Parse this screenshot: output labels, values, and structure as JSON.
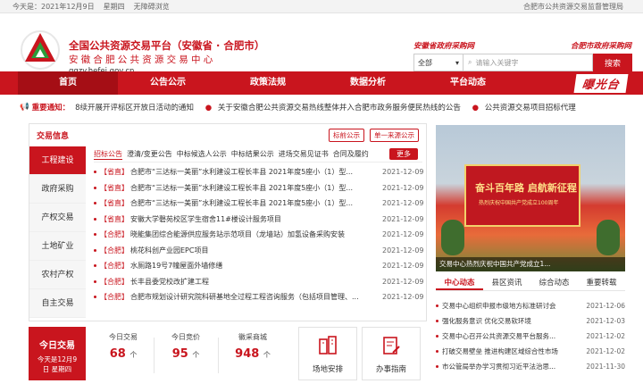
{
  "topbar": {
    "today_label": "今天是：",
    "date": "2021年12月9日",
    "weekday": "星期四",
    "accessibility": "无障碍浏览",
    "right": "合肥市公共资源交易监督管理局"
  },
  "header": {
    "title": "全国公共资源交易平台（安徽省 · 合肥市）",
    "subtitle": "安徽合肥公共资源交易中心",
    "url": "ggzy.hefei.gov.cn",
    "link1": "安徽省政府采购网",
    "link2": "合肥市政府采购网"
  },
  "search": {
    "select": "全部",
    "placeholder": "请输入关键字",
    "button": "搜索"
  },
  "nav": {
    "items": [
      "首页",
      "公告公示",
      "政策法规",
      "数据分析",
      "平台动态"
    ],
    "special": "曝光台"
  },
  "notice": {
    "label": "重要通知：",
    "items": [
      "8续开展开评标区开放日活动的通知",
      "关于安徽合肥公共资源交易热线整体并入合肥市政务服务便民热线的公告",
      "公共资源交易项目招标代理"
    ]
  },
  "transaction": {
    "title": "交易信息",
    "top_tabs": [
      "标前公示",
      "单一来源公示"
    ],
    "categories": [
      "工程建设",
      "政府采购",
      "产权交易",
      "土地矿业",
      "农村产权",
      "自主交易"
    ],
    "subtabs": [
      "招标公告",
      "澄清/变更公告",
      "中标候选人公示",
      "中标结果公示",
      "进场交易见证书",
      "合同及履约"
    ],
    "more": "更多",
    "rows": [
      {
        "tag": "【省直】",
        "text": "合肥市“三达标一美丽”水利建设工程长丰县 2021年度5座小（1）型...",
        "date": "2021-12-09"
      },
      {
        "tag": "【省直】",
        "text": "合肥市“三达标一美丽”水利建设工程长丰县 2021年度5座小（1）型...",
        "date": "2021-12-09"
      },
      {
        "tag": "【省直】",
        "text": "合肥市“三达标一美丽”水利建设工程长丰县 2021年度5座小（1）型...",
        "date": "2021-12-09"
      },
      {
        "tag": "【省直】",
        "text": "安徽大学磬苑校区学生宿舍11#楼设计服务项目",
        "date": "2021-12-09"
      },
      {
        "tag": "【合肥】",
        "text": "晓能集团综合能源供应服务站示范项目（龙墙站）加氢设备采购安装",
        "date": "2021-12-09"
      },
      {
        "tag": "【合肥】",
        "text": "桃花科创产业园EPC项目",
        "date": "2021-12-09"
      },
      {
        "tag": "【合肥】",
        "text": "水厕路19号7幢屋面外墙修缮",
        "date": "2021-12-09"
      },
      {
        "tag": "【合肥】",
        "text": "长丰县委党校改扩建工程",
        "date": "2021-12-09"
      },
      {
        "tag": "【合肥】",
        "text": "合肥市规划设计研究院科研基地全过程工程咨询服务（包括项目管理、...",
        "date": "2021-12-09"
      }
    ]
  },
  "photo": {
    "caption": "交易中心热烈庆祝中国共产党成立1...",
    "banner": "奋斗百年路 启航新征程",
    "banner_sub": "热烈庆祝中国共产党成立100周年"
  },
  "news": {
    "tabs": [
      "中心动态",
      "县区资讯",
      "综合动态",
      "重要转载"
    ],
    "rows": [
      {
        "text": "交易中心组织申报市级地方标准研讨会",
        "date": "2021-12-06"
      },
      {
        "text": "强化服务意识 优化交易软环境",
        "date": "2021-12-03"
      },
      {
        "text": "交易中心召开公共资源交易平台服务...",
        "date": "2021-12-02"
      },
      {
        "text": "打破交易壁垒 推进构建区域综合性市场",
        "date": "2021-12-02"
      },
      {
        "text": "市公管局举办学习贯彻习近平法治思...",
        "date": "2021-11-30"
      }
    ]
  },
  "stats": {
    "today_title": "今日交易",
    "today_date": "今天是12月9",
    "today_weekday": "日 星期四",
    "items": [
      {
        "label": "今日交易",
        "value": "68",
        "unit": "个"
      },
      {
        "label": "今日竞价",
        "value": "95",
        "unit": "个"
      },
      {
        "label": "徽采商城",
        "value": "948",
        "unit": "个"
      }
    ],
    "services": [
      "场地安排",
      "办事指南"
    ]
  }
}
